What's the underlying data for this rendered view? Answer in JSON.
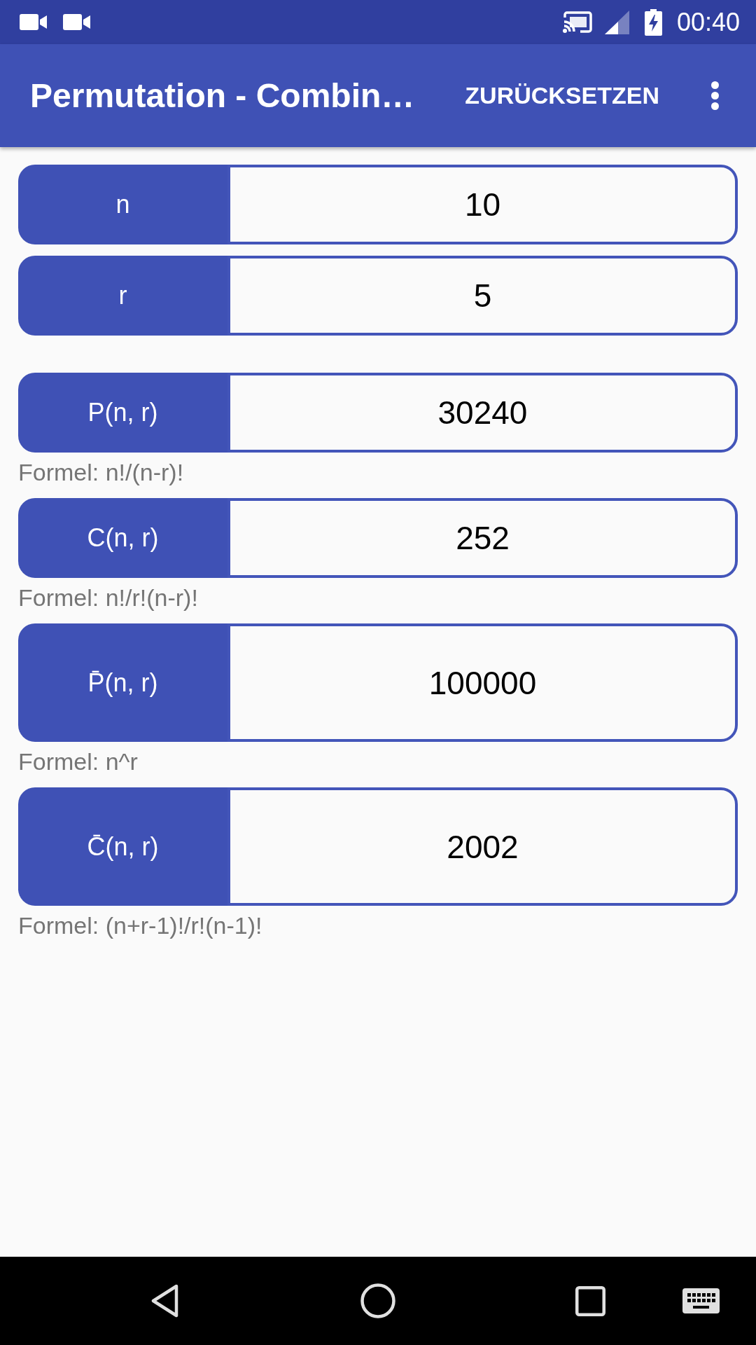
{
  "status_bar": {
    "time": "00:40"
  },
  "app_bar": {
    "title": "Permutation - Combin…",
    "action": "ZURÜCKSETZEN"
  },
  "inputs": [
    {
      "label": "n",
      "value": "10"
    },
    {
      "label": "r",
      "value": "5"
    }
  ],
  "results": [
    {
      "label": "P(n, r)",
      "value": "30240",
      "formula": "Formel: n!/(n-r)!"
    },
    {
      "label": "C(n, r)",
      "value": "252",
      "formula": "Formel: n!/r!(n-r)!"
    },
    {
      "label": "P̄(n, r)",
      "value": "100000",
      "formula": "Formel: n^r"
    },
    {
      "label": "C̄(n, r)",
      "value": "2002",
      "formula": "Formel: (n+r-1)!/r!(n-1)!"
    }
  ]
}
